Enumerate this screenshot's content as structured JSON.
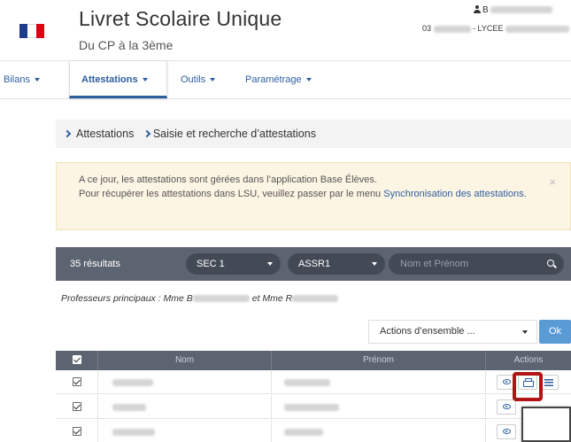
{
  "header": {
    "app_title": "Livret Scolaire Unique",
    "app_subtitle": "Du CP à la 3ème",
    "user_prefix": "B",
    "school_prefix": "03",
    "school_label": "- LYCEE"
  },
  "nav": {
    "items": [
      {
        "label": "Bilans"
      },
      {
        "label": "Attestations"
      },
      {
        "label": "Outils"
      },
      {
        "label": "Paramétrage"
      }
    ]
  },
  "breadcrumb": {
    "items": [
      "Attestations",
      "Saisie et recherche d’attestations"
    ]
  },
  "alert": {
    "line1": "A ce jour, les attestations sont gérées dans l’application Base Élèves.",
    "line2": "Pour récupérer les attestations dans LSU, veuillez passer par le menu",
    "link": "Synchronisation des attestations",
    "end": ".",
    "close": "×"
  },
  "filters": {
    "results": "35 résultats",
    "class_value": "SEC 1",
    "attestation_value": "ASSR1",
    "search_placeholder": "Nom et Prénom"
  },
  "profs": {
    "prefix": "Professeurs principaux : Mme B",
    "middle": "et Mme R"
  },
  "bulk": {
    "select_label": "Actions d’ensemble ...",
    "ok_label": "Ok"
  },
  "table": {
    "headers": [
      "Nom",
      "Prénom",
      "Actions"
    ]
  }
}
